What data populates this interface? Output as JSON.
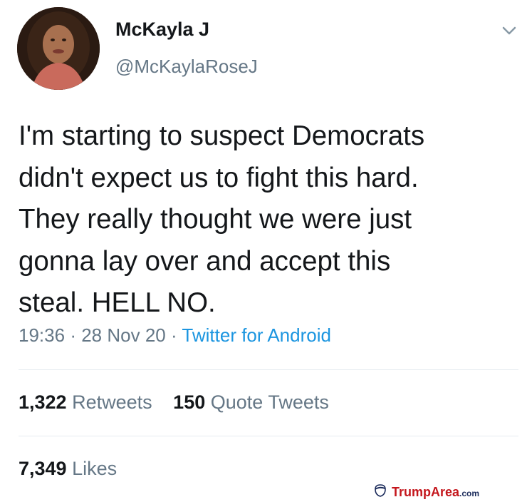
{
  "user": {
    "display_name": "McKayla J",
    "handle": "@McKaylaRoseJ"
  },
  "tweet": {
    "text_lines": [
      "I'm starting to suspect Democrats",
      "didn't expect us to fight this hard.",
      "They really thought we were just",
      "gonna lay over and accept this",
      "steal. HELL NO."
    ],
    "time": "19:36",
    "date": "28 Nov 20",
    "separator": "·",
    "source": "Twitter for Android"
  },
  "stats": {
    "retweets": {
      "count": "1,322",
      "label": "Retweets"
    },
    "quote_tweets": {
      "count": "150",
      "label": "Quote Tweets"
    },
    "likes": {
      "count": "7,349",
      "label": "Likes"
    }
  },
  "watermark": {
    "name": "TrumpArea",
    "domain": ".com"
  },
  "icons": {
    "menu": "chevron-down-icon",
    "watermark": "trump-logo-icon"
  },
  "colors": {
    "text": "#14171a",
    "secondary": "#657786",
    "link": "#1b95e0",
    "divider": "#e6ecf0",
    "watermark_red": "#c4161c",
    "watermark_navy": "#1a2a5a"
  }
}
